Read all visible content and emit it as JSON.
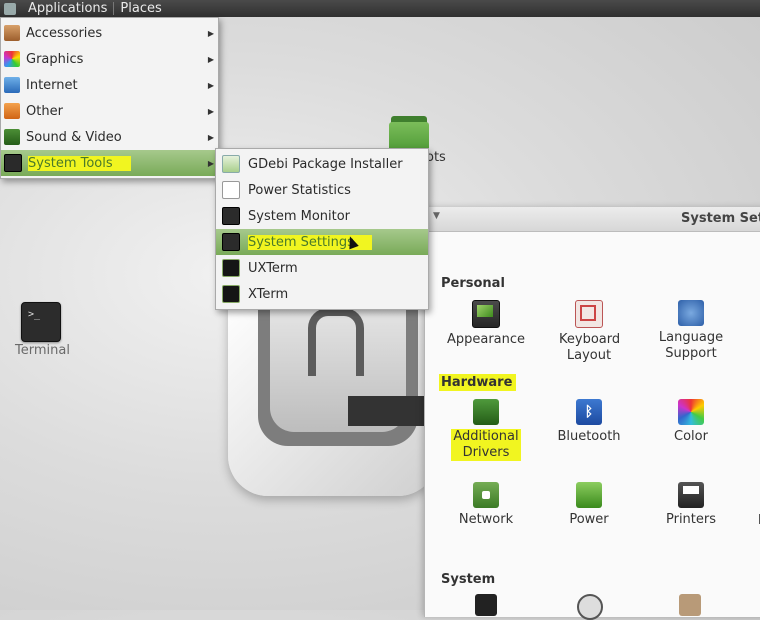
{
  "top_panel": {
    "applications": "Applications",
    "places": "Places"
  },
  "desktop": {
    "folder_label": "ots",
    "terminal_label": "Terminal",
    "terminal_glyph": ">_"
  },
  "main_menu": {
    "items": [
      {
        "label": "Accessories",
        "icon": "accessories-icon"
      },
      {
        "label": "Graphics",
        "icon": "graphics-icon"
      },
      {
        "label": "Internet",
        "icon": "internet-icon"
      },
      {
        "label": "Other",
        "icon": "other-icon"
      },
      {
        "label": "Sound & Video",
        "icon": "sound-video-icon"
      },
      {
        "label": "System Tools",
        "icon": "system-tools-icon",
        "active": true
      }
    ],
    "arrow": "▶"
  },
  "sub_menu": {
    "items": [
      {
        "label": "GDebi Package Installer",
        "icon": "gdebi-icon"
      },
      {
        "label": "Power Statistics",
        "icon": "power-statistics-icon"
      },
      {
        "label": "System Monitor",
        "icon": "system-monitor-icon"
      },
      {
        "label": "System Settings",
        "icon": "system-settings-icon",
        "active": true
      },
      {
        "label": "UXTerm",
        "icon": "uxterm-icon"
      },
      {
        "label": "XTerm",
        "icon": "xterm-icon"
      }
    ]
  },
  "settings_window": {
    "title": "System Set",
    "title_arrow": "▼",
    "sections": {
      "personal": "Personal",
      "hardware": "Hardware",
      "system": "System"
    },
    "personal_items": [
      {
        "label": "Appearance",
        "icon": "appearance-icon"
      },
      {
        "label": "Keyboard Layout",
        "icon": "keyboard-layout-icon"
      },
      {
        "label": "Language Support",
        "icon": "language-support-icon"
      }
    ],
    "hardware_items": [
      {
        "label": "Additional Drivers",
        "icon": "additional-drivers-icon"
      },
      {
        "label": "Bluetooth",
        "icon": "bluetooth-icon"
      },
      {
        "label": "Color",
        "icon": "color-icon"
      },
      {
        "label": "Network",
        "icon": "network-icon"
      },
      {
        "label": "Power",
        "icon": "power-icon"
      },
      {
        "label": "Printers",
        "icon": "printers-icon"
      }
    ],
    "bluetooth_glyph": "ᛒ"
  },
  "colors": {
    "highlight": "#f1f520",
    "menu_active": "#79aa58",
    "panel": "#303030"
  }
}
